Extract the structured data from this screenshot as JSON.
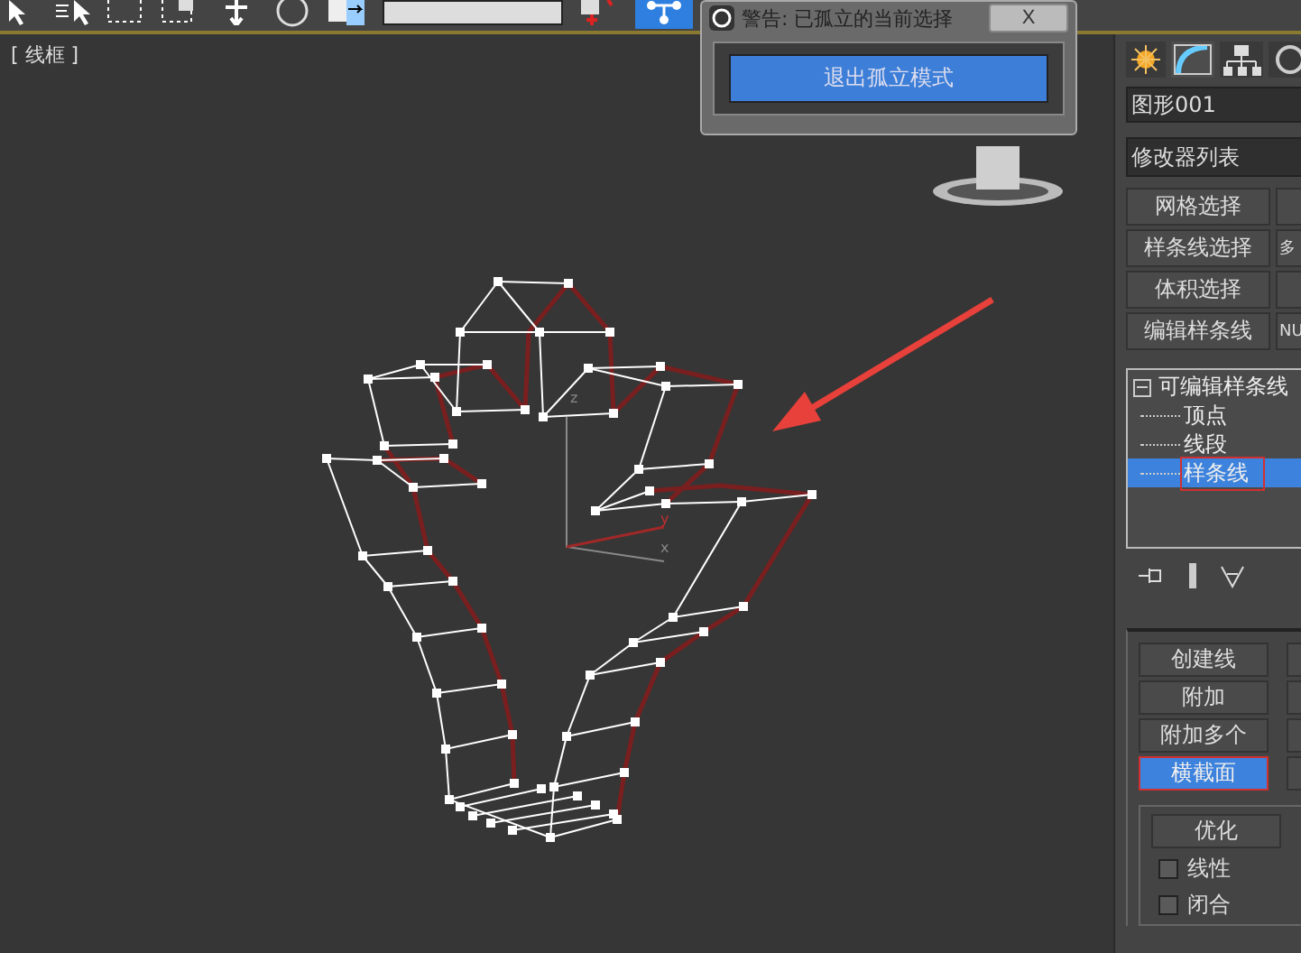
{
  "viewport": {
    "label": "[ 线框 ]",
    "gizmo_labels": [
      "z",
      "y",
      "x"
    ]
  },
  "dialog": {
    "title": "警告: 已孤立的当前选择",
    "close": "X",
    "button": "退出孤立模式"
  },
  "command_panel": {
    "object_name": "图形001",
    "modifier_list": "修改器列表",
    "modifier_buttons": [
      {
        "left": "网格选择"
      },
      {
        "left": "样条线选择",
        "right": "多"
      },
      {
        "left": "体积选择"
      },
      {
        "left": "编辑样条线",
        "right": "NU"
      }
    ],
    "stack": {
      "name": "可编辑样条线",
      "expanded": true,
      "children": [
        {
          "label": "顶点",
          "selected": false
        },
        {
          "label": "线段",
          "selected": false
        },
        {
          "label": "样条线",
          "selected": true
        }
      ]
    },
    "geometry": {
      "buttons": [
        {
          "label": "创建线",
          "selected": false
        },
        {
          "label": "附加",
          "selected": false
        },
        {
          "label": "附加多个",
          "selected": false
        },
        {
          "label": "横截面",
          "selected": true
        }
      ],
      "refine": "优化",
      "options": [
        {
          "label": "线性",
          "checked": false
        },
        {
          "label": "闭合",
          "checked": false
        }
      ]
    }
  }
}
